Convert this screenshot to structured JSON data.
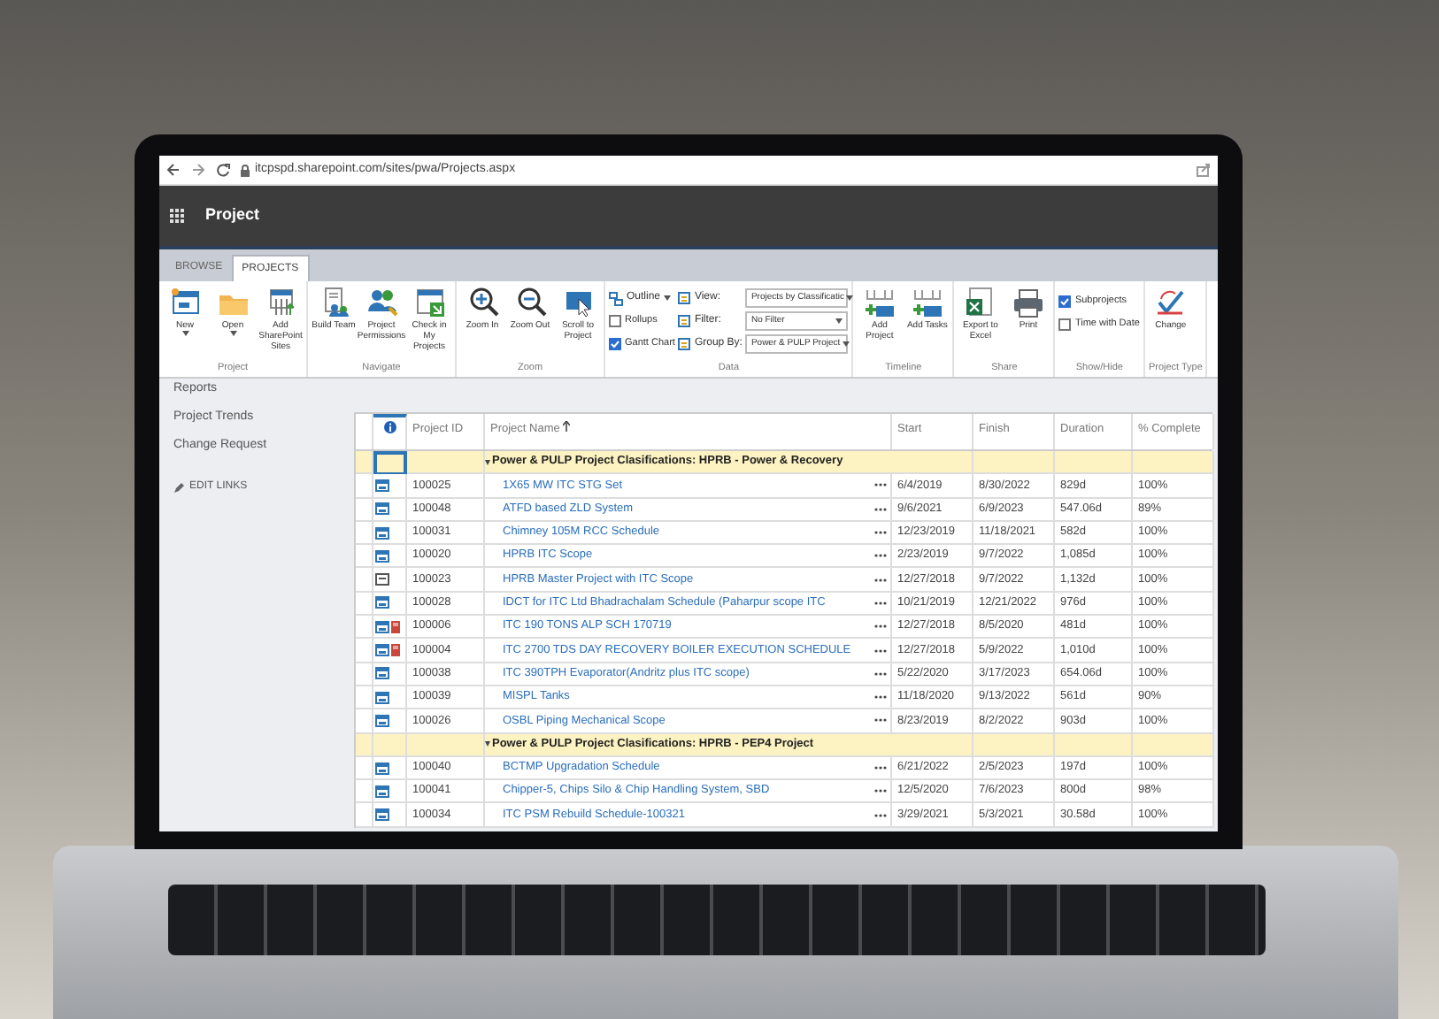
{
  "browser": {
    "url": "itcpspd.sharepoint.com/sites/pwa/Projects.aspx"
  },
  "app": {
    "title": "Project"
  },
  "tabs": [
    {
      "label": "BROWSE",
      "selected": false
    },
    {
      "label": "PROJECTS",
      "selected": true
    }
  ],
  "ribbon": {
    "groups": [
      {
        "label": "Project",
        "items": [
          {
            "kind": "button",
            "label": "New",
            "dropdown": true
          },
          {
            "kind": "button",
            "label": "Open",
            "dropdown": true
          },
          {
            "kind": "button",
            "label": "Add SharePoint Sites",
            "dropdown": false
          }
        ]
      },
      {
        "label": "Navigate",
        "items": [
          {
            "kind": "button",
            "label": "Build Team",
            "dropdown": false
          },
          {
            "kind": "button",
            "label": "Project Permissions",
            "dropdown": false
          },
          {
            "kind": "button",
            "label": "Check in My Projects",
            "dropdown": false
          }
        ]
      },
      {
        "label": "Zoom",
        "items": [
          {
            "kind": "button",
            "label": "Zoom In",
            "dropdown": false
          },
          {
            "kind": "button",
            "label": "Zoom Out",
            "dropdown": false
          },
          {
            "kind": "button",
            "label": "Scroll to Project",
            "dropdown": false
          }
        ]
      },
      {
        "label": "Data",
        "items": [
          {
            "kind": "menu",
            "label": "Outline"
          },
          {
            "kind": "checkbox",
            "label": "Rollups",
            "checked": false
          },
          {
            "kind": "checkbox",
            "label": "Gantt Chart",
            "checked": true
          },
          {
            "kind": "select",
            "label": "View:",
            "value": "Projects by Classificatic"
          },
          {
            "kind": "select",
            "label": "Filter:",
            "value": "No Filter"
          },
          {
            "kind": "select",
            "label": "Group By:",
            "value": "Power & PULP Project"
          }
        ]
      },
      {
        "label": "Timeline",
        "items": [
          {
            "kind": "button",
            "label": "Add Project",
            "dropdown": false
          },
          {
            "kind": "button",
            "label": "Add Tasks",
            "dropdown": false
          }
        ]
      },
      {
        "label": "Share",
        "items": [
          {
            "kind": "button",
            "label": "Export to Excel",
            "dropdown": false
          },
          {
            "kind": "button",
            "label": "Print",
            "dropdown": false
          }
        ]
      },
      {
        "label": "Show/Hide",
        "items": [
          {
            "kind": "checkbox",
            "label": "Subprojects",
            "checked": true
          },
          {
            "kind": "checkbox",
            "label": "Time with Date",
            "checked": false
          }
        ]
      },
      {
        "label": "Project Type",
        "items": [
          {
            "kind": "button",
            "label": "Change",
            "dropdown": false
          }
        ]
      }
    ]
  },
  "sidebar": {
    "items": [
      "Reports",
      "Project Trends",
      "Change Request"
    ],
    "edit_links": "EDIT LINKS"
  },
  "table": {
    "columns": [
      {
        "label": "Project ID",
        "sorted": false
      },
      {
        "label": "Project Name",
        "sorted": true
      },
      {
        "label": "Start",
        "sorted": false
      },
      {
        "label": "Finish",
        "sorted": false
      },
      {
        "label": "Duration",
        "sorted": false
      },
      {
        "label": "% Complete",
        "sorted": false
      }
    ],
    "groups": [
      {
        "heading": "Power & PULP Project Clasifications: HPRB - Power & Recovery",
        "focused": true,
        "rows": [
          {
            "kind": "project",
            "checked_out": false,
            "id": "100025",
            "name": "1X65 MW ITC STG Set",
            "start": "6/4/2019",
            "finish": "8/30/2022",
            "duration": "829d",
            "complete": "100%"
          },
          {
            "kind": "project",
            "checked_out": false,
            "id": "100048",
            "name": "ATFD based ZLD System",
            "start": "9/6/2021",
            "finish": "6/9/2023",
            "duration": "547.06d",
            "complete": "89%"
          },
          {
            "kind": "project",
            "checked_out": false,
            "id": "100031",
            "name": "Chimney 105M RCC Schedule",
            "start": "12/23/2019",
            "finish": "11/18/2021",
            "duration": "582d",
            "complete": "100%"
          },
          {
            "kind": "project",
            "checked_out": false,
            "id": "100020",
            "name": "HPRB ITC Scope",
            "start": "2/23/2019",
            "finish": "9/7/2022",
            "duration": "1,085d",
            "complete": "100%"
          },
          {
            "kind": "plain",
            "checked_out": false,
            "id": "100023",
            "name": "HPRB Master Project with ITC Scope",
            "start": "12/27/2018",
            "finish": "9/7/2022",
            "duration": "1,132d",
            "complete": "100%"
          },
          {
            "kind": "project",
            "checked_out": false,
            "id": "100028",
            "name": "IDCT for ITC Ltd Bhadrachalam Schedule (Paharpur scope ITC",
            "start": "10/21/2019",
            "finish": "12/21/2022",
            "duration": "976d",
            "complete": "100%"
          },
          {
            "kind": "project",
            "checked_out": true,
            "id": "100006",
            "name": "ITC 190 TONS ALP SCH 170719",
            "start": "12/27/2018",
            "finish": "8/5/2020",
            "duration": "481d",
            "complete": "100%"
          },
          {
            "kind": "project",
            "checked_out": true,
            "id": "100004",
            "name": "ITC 2700 TDS DAY RECOVERY BOILER EXECUTION SCHEDULE",
            "start": "12/27/2018",
            "finish": "5/9/2022",
            "duration": "1,010d",
            "complete": "100%"
          },
          {
            "kind": "project",
            "checked_out": false,
            "id": "100038",
            "name": "ITC 390TPH Evaporator(Andritz plus ITC scope)",
            "start": "5/22/2020",
            "finish": "3/17/2023",
            "duration": "654.06d",
            "complete": "100%"
          },
          {
            "kind": "project",
            "checked_out": false,
            "id": "100039",
            "name": "MISPL Tanks",
            "start": "11/18/2020",
            "finish": "9/13/2022",
            "duration": "561d",
            "complete": "90%"
          },
          {
            "kind": "project",
            "checked_out": false,
            "id": "100026",
            "name": "OSBL Piping Mechanical Scope",
            "start": "8/23/2019",
            "finish": "8/2/2022",
            "duration": "903d",
            "complete": "100%"
          }
        ]
      },
      {
        "heading": "Power & PULP Project Clasifications: HPRB - PEP4 Project",
        "focused": false,
        "rows": [
          {
            "kind": "project",
            "checked_out": false,
            "id": "100040",
            "name": "BCTMP Upgradation Schedule",
            "start": "6/21/2022",
            "finish": "2/5/2023",
            "duration": "197d",
            "complete": "100%"
          },
          {
            "kind": "project",
            "checked_out": false,
            "id": "100041",
            "name": "Chipper-5, Chips Silo & Chip Handling System, SBD",
            "start": "12/5/2020",
            "finish": "7/6/2023",
            "duration": "800d",
            "complete": "98%"
          },
          {
            "kind": "project",
            "checked_out": false,
            "id": "100034",
            "name": "ITC PSM Rebuild Schedule-100321",
            "start": "3/29/2021",
            "finish": "5/3/2021",
            "duration": "30.58d",
            "complete": "100%"
          }
        ]
      }
    ]
  }
}
